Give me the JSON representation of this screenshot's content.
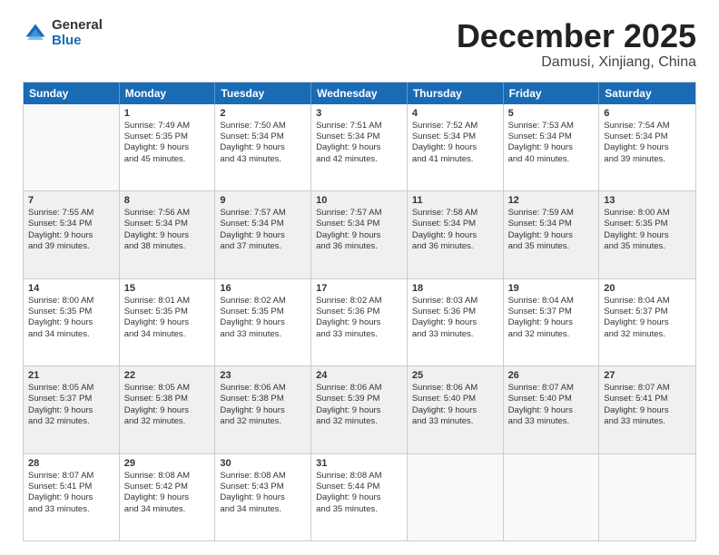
{
  "logo": {
    "general": "General",
    "blue": "Blue"
  },
  "title": "December 2025",
  "location": "Damusi, Xinjiang, China",
  "header_days": [
    "Sunday",
    "Monday",
    "Tuesday",
    "Wednesday",
    "Thursday",
    "Friday",
    "Saturday"
  ],
  "weeks": [
    [
      {
        "day": "",
        "sunrise": "",
        "sunset": "",
        "daylight": "",
        "empty": true
      },
      {
        "day": "1",
        "sunrise": "Sunrise: 7:49 AM",
        "sunset": "Sunset: 5:35 PM",
        "daylight": "Daylight: 9 hours",
        "daylight2": "and 45 minutes."
      },
      {
        "day": "2",
        "sunrise": "Sunrise: 7:50 AM",
        "sunset": "Sunset: 5:34 PM",
        "daylight": "Daylight: 9 hours",
        "daylight2": "and 43 minutes."
      },
      {
        "day": "3",
        "sunrise": "Sunrise: 7:51 AM",
        "sunset": "Sunset: 5:34 PM",
        "daylight": "Daylight: 9 hours",
        "daylight2": "and 42 minutes."
      },
      {
        "day": "4",
        "sunrise": "Sunrise: 7:52 AM",
        "sunset": "Sunset: 5:34 PM",
        "daylight": "Daylight: 9 hours",
        "daylight2": "and 41 minutes."
      },
      {
        "day": "5",
        "sunrise": "Sunrise: 7:53 AM",
        "sunset": "Sunset: 5:34 PM",
        "daylight": "Daylight: 9 hours",
        "daylight2": "and 40 minutes."
      },
      {
        "day": "6",
        "sunrise": "Sunrise: 7:54 AM",
        "sunset": "Sunset: 5:34 PM",
        "daylight": "Daylight: 9 hours",
        "daylight2": "and 39 minutes."
      }
    ],
    [
      {
        "day": "7",
        "sunrise": "Sunrise: 7:55 AM",
        "sunset": "Sunset: 5:34 PM",
        "daylight": "Daylight: 9 hours",
        "daylight2": "and 39 minutes."
      },
      {
        "day": "8",
        "sunrise": "Sunrise: 7:56 AM",
        "sunset": "Sunset: 5:34 PM",
        "daylight": "Daylight: 9 hours",
        "daylight2": "and 38 minutes."
      },
      {
        "day": "9",
        "sunrise": "Sunrise: 7:57 AM",
        "sunset": "Sunset: 5:34 PM",
        "daylight": "Daylight: 9 hours",
        "daylight2": "and 37 minutes."
      },
      {
        "day": "10",
        "sunrise": "Sunrise: 7:57 AM",
        "sunset": "Sunset: 5:34 PM",
        "daylight": "Daylight: 9 hours",
        "daylight2": "and 36 minutes."
      },
      {
        "day": "11",
        "sunrise": "Sunrise: 7:58 AM",
        "sunset": "Sunset: 5:34 PM",
        "daylight": "Daylight: 9 hours",
        "daylight2": "and 36 minutes."
      },
      {
        "day": "12",
        "sunrise": "Sunrise: 7:59 AM",
        "sunset": "Sunset: 5:34 PM",
        "daylight": "Daylight: 9 hours",
        "daylight2": "and 35 minutes."
      },
      {
        "day": "13",
        "sunrise": "Sunrise: 8:00 AM",
        "sunset": "Sunset: 5:35 PM",
        "daylight": "Daylight: 9 hours",
        "daylight2": "and 35 minutes."
      }
    ],
    [
      {
        "day": "14",
        "sunrise": "Sunrise: 8:00 AM",
        "sunset": "Sunset: 5:35 PM",
        "daylight": "Daylight: 9 hours",
        "daylight2": "and 34 minutes."
      },
      {
        "day": "15",
        "sunrise": "Sunrise: 8:01 AM",
        "sunset": "Sunset: 5:35 PM",
        "daylight": "Daylight: 9 hours",
        "daylight2": "and 34 minutes."
      },
      {
        "day": "16",
        "sunrise": "Sunrise: 8:02 AM",
        "sunset": "Sunset: 5:35 PM",
        "daylight": "Daylight: 9 hours",
        "daylight2": "and 33 minutes."
      },
      {
        "day": "17",
        "sunrise": "Sunrise: 8:02 AM",
        "sunset": "Sunset: 5:36 PM",
        "daylight": "Daylight: 9 hours",
        "daylight2": "and 33 minutes."
      },
      {
        "day": "18",
        "sunrise": "Sunrise: 8:03 AM",
        "sunset": "Sunset: 5:36 PM",
        "daylight": "Daylight: 9 hours",
        "daylight2": "and 33 minutes."
      },
      {
        "day": "19",
        "sunrise": "Sunrise: 8:04 AM",
        "sunset": "Sunset: 5:37 PM",
        "daylight": "Daylight: 9 hours",
        "daylight2": "and 32 minutes."
      },
      {
        "day": "20",
        "sunrise": "Sunrise: 8:04 AM",
        "sunset": "Sunset: 5:37 PM",
        "daylight": "Daylight: 9 hours",
        "daylight2": "and 32 minutes."
      }
    ],
    [
      {
        "day": "21",
        "sunrise": "Sunrise: 8:05 AM",
        "sunset": "Sunset: 5:37 PM",
        "daylight": "Daylight: 9 hours",
        "daylight2": "and 32 minutes."
      },
      {
        "day": "22",
        "sunrise": "Sunrise: 8:05 AM",
        "sunset": "Sunset: 5:38 PM",
        "daylight": "Daylight: 9 hours",
        "daylight2": "and 32 minutes."
      },
      {
        "day": "23",
        "sunrise": "Sunrise: 8:06 AM",
        "sunset": "Sunset: 5:38 PM",
        "daylight": "Daylight: 9 hours",
        "daylight2": "and 32 minutes."
      },
      {
        "day": "24",
        "sunrise": "Sunrise: 8:06 AM",
        "sunset": "Sunset: 5:39 PM",
        "daylight": "Daylight: 9 hours",
        "daylight2": "and 32 minutes."
      },
      {
        "day": "25",
        "sunrise": "Sunrise: 8:06 AM",
        "sunset": "Sunset: 5:40 PM",
        "daylight": "Daylight: 9 hours",
        "daylight2": "and 33 minutes."
      },
      {
        "day": "26",
        "sunrise": "Sunrise: 8:07 AM",
        "sunset": "Sunset: 5:40 PM",
        "daylight": "Daylight: 9 hours",
        "daylight2": "and 33 minutes."
      },
      {
        "day": "27",
        "sunrise": "Sunrise: 8:07 AM",
        "sunset": "Sunset: 5:41 PM",
        "daylight": "Daylight: 9 hours",
        "daylight2": "and 33 minutes."
      }
    ],
    [
      {
        "day": "28",
        "sunrise": "Sunrise: 8:07 AM",
        "sunset": "Sunset: 5:41 PM",
        "daylight": "Daylight: 9 hours",
        "daylight2": "and 33 minutes."
      },
      {
        "day": "29",
        "sunrise": "Sunrise: 8:08 AM",
        "sunset": "Sunset: 5:42 PM",
        "daylight": "Daylight: 9 hours",
        "daylight2": "and 34 minutes."
      },
      {
        "day": "30",
        "sunrise": "Sunrise: 8:08 AM",
        "sunset": "Sunset: 5:43 PM",
        "daylight": "Daylight: 9 hours",
        "daylight2": "and 34 minutes."
      },
      {
        "day": "31",
        "sunrise": "Sunrise: 8:08 AM",
        "sunset": "Sunset: 5:44 PM",
        "daylight": "Daylight: 9 hours",
        "daylight2": "and 35 minutes."
      },
      {
        "day": "",
        "sunrise": "",
        "sunset": "",
        "daylight": "",
        "daylight2": "",
        "empty": true
      },
      {
        "day": "",
        "sunrise": "",
        "sunset": "",
        "daylight": "",
        "daylight2": "",
        "empty": true
      },
      {
        "day": "",
        "sunrise": "",
        "sunset": "",
        "daylight": "",
        "daylight2": "",
        "empty": true
      }
    ]
  ]
}
